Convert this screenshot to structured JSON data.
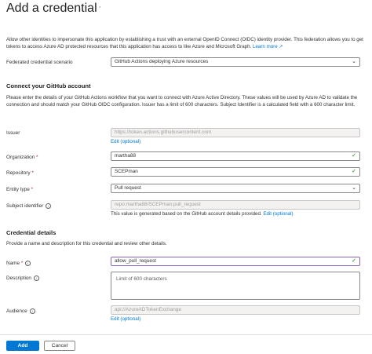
{
  "header": {
    "title": "Add a credential",
    "more_label": "···"
  },
  "intro": {
    "text": "Allow other identities to impersonate this application by establishing a trust with an external OpenID Connect (OIDC) identity provider. This federation allows you to get tokens to access Azure AD protected resources that this application has access to like Azure and Microsoft Graph.",
    "learn_more": "Learn more"
  },
  "scenario": {
    "label": "Federated credential scenario",
    "value": "GitHub Actions deploying Azure resources"
  },
  "github": {
    "heading": "Connect your GitHub account",
    "description": "Please enter the details of your GitHub Actions workflow that you want to connect with Azure Active Directory. These values will be used by Azure AD to validate the connection and should match your GitHub OIDC configuration. Issuer has a limit of 600 characters. Subject Identifier is a calculated field with a 600 character limit.",
    "issuer_label": "Issuer",
    "issuer_value": "https://token.actions.githubusercontent.com",
    "edit_optional": "Edit (optional)",
    "organization_label": "Organization",
    "organization_value": "martha88",
    "repository_label": "Repository",
    "repository_value": "SCEPman",
    "entity_label": "Entity type",
    "entity_value": "Pull request",
    "subject_label": "Subject identifier",
    "subject_value": "repo:martha88/SCEPman:pull_request",
    "subject_helper": "This value is generated based on the GitHub account details provided.",
    "edit_short": "Edit (optional)"
  },
  "credential": {
    "heading": "Credential details",
    "description": "Provide a name and description for this credential and review other details.",
    "name_label": "Name",
    "name_value": "allow_pull_request",
    "description_label": "Description",
    "description_placeholder": "Limit of 600 characters",
    "audience_label": "Audience",
    "audience_value": "api://AzureADTokenExchange",
    "audience_edit": "Edit (optional)"
  },
  "footer": {
    "add_label": "Add",
    "cancel_label": "Cancel"
  },
  "colors": {
    "accent": "#0078d4",
    "focus": "#8764b8",
    "valid": "#107c10",
    "required": "#a4262c"
  }
}
